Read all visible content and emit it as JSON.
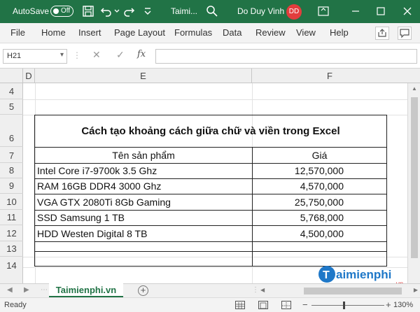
{
  "titlebar": {
    "autosave_label": "AutoSave",
    "autosave_state": "Off",
    "file_name": "Taimi...",
    "user_name": "Do Duy Vinh",
    "user_initials": "DD",
    "accent_color": "#217346",
    "avatar_color": "#e23d3d"
  },
  "menu": {
    "items": [
      "File",
      "Home",
      "Insert",
      "Page Layout",
      "Formulas",
      "Data",
      "Review",
      "View",
      "Help"
    ]
  },
  "formula_bar": {
    "name_box": "H21",
    "cancel_symbol": "✕",
    "enter_symbol": "✓",
    "function_symbol": "fx",
    "formula_value": ""
  },
  "grid": {
    "columns": [
      "D",
      "E",
      "F"
    ],
    "rows": [
      "4",
      "5",
      "6",
      "7",
      "8",
      "9",
      "10",
      "11",
      "12",
      "13",
      "14"
    ]
  },
  "table": {
    "title": "Cách tạo khoảng cách giữa chữ và viền trong Excel",
    "headers": {
      "product": "Tên sản phẩm",
      "price": "Giá"
    },
    "rows": [
      {
        "product": "Intel Core i7-9700k 3.5 Ghz",
        "price": "12,570,000"
      },
      {
        "product": "RAM 16GB DDR4 3000 Ghz",
        "price": "4,570,000"
      },
      {
        "product": "VGA GTX 2080Ti 8Gb Gaming",
        "price": "25,750,000"
      },
      {
        "product": "SSD Samsung 1 TB",
        "price": "5,768,000"
      },
      {
        "product": "HDD Westen Digital 8 TB",
        "price": "4,500,000"
      }
    ]
  },
  "watermark": {
    "brand": "aimienphi",
    "suffix": ".vn"
  },
  "sheet_tabs": {
    "active": "Taimienphi.vn",
    "add_symbol": "+"
  },
  "statusbar": {
    "status": "Ready",
    "zoom": "130%",
    "zoom_minus": "−",
    "zoom_plus": "+"
  }
}
